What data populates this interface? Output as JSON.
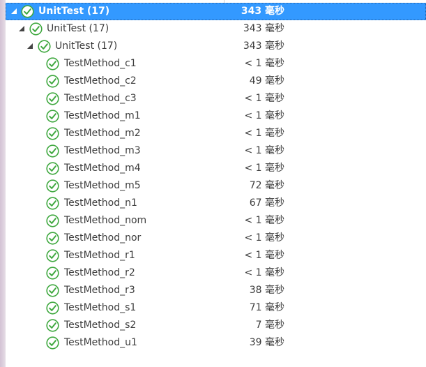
{
  "tree": {
    "root": {
      "name": "UnitTest (17)",
      "duration": "343 毫秒",
      "status": "passed"
    },
    "level1": {
      "name": "UnitTest (17)",
      "duration": "343 毫秒",
      "status": "passed"
    },
    "level2": {
      "name": "UnitTest (17)",
      "duration": "343 毫秒",
      "status": "passed"
    },
    "tests": [
      {
        "name": "TestMethod_c1",
        "duration": "< 1 毫秒",
        "status": "passed"
      },
      {
        "name": "TestMethod_c2",
        "duration": "49 毫秒",
        "status": "passed"
      },
      {
        "name": "TestMethod_c3",
        "duration": "< 1 毫秒",
        "status": "passed"
      },
      {
        "name": "TestMethod_m1",
        "duration": "< 1 毫秒",
        "status": "passed"
      },
      {
        "name": "TestMethod_m2",
        "duration": "< 1 毫秒",
        "status": "passed"
      },
      {
        "name": "TestMethod_m3",
        "duration": "< 1 毫秒",
        "status": "passed"
      },
      {
        "name": "TestMethod_m4",
        "duration": "< 1 毫秒",
        "status": "passed"
      },
      {
        "name": "TestMethod_m5",
        "duration": "72 毫秒",
        "status": "passed"
      },
      {
        "name": "TestMethod_n1",
        "duration": "67 毫秒",
        "status": "passed"
      },
      {
        "name": "TestMethod_nom",
        "duration": "< 1 毫秒",
        "status": "passed"
      },
      {
        "name": "TestMethod_nor",
        "duration": "< 1 毫秒",
        "status": "passed"
      },
      {
        "name": "TestMethod_r1",
        "duration": "< 1 毫秒",
        "status": "passed"
      },
      {
        "name": "TestMethod_r2",
        "duration": "< 1 毫秒",
        "status": "passed"
      },
      {
        "name": "TestMethod_r3",
        "duration": "38 毫秒",
        "status": "passed"
      },
      {
        "name": "TestMethod_s1",
        "duration": "71 毫秒",
        "status": "passed"
      },
      {
        "name": "TestMethod_s2",
        "duration": "7 毫秒",
        "status": "passed"
      },
      {
        "name": "TestMethod_u1",
        "duration": "39 毫秒",
        "status": "passed"
      }
    ]
  },
  "colors": {
    "selection": "#3399ff",
    "pass_green": "#3fa83f",
    "text": "#3c3c3c"
  },
  "icons": {
    "passed": "check-circle-icon",
    "expander": "expanded-triangle-icon"
  }
}
